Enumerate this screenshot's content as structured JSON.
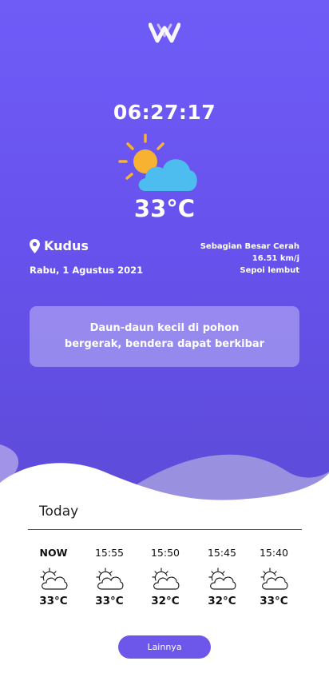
{
  "app": {
    "accent": "#6c57ea",
    "brand_logo": "w-logo"
  },
  "current": {
    "time": "06:27:17",
    "icon": "sun-cloud-icon",
    "temperature": "33°C",
    "location": "Kudus",
    "date": "Rabu, 1 Agustus 2021",
    "condition": "Sebagian Besar Cerah",
    "wind_speed": "16.51 km/j",
    "wind_name": "Sepoi lembut",
    "description": "Daun-daun kecil di pohon bergerak, bendera dapat berkibar"
  },
  "forecast": {
    "title": "Today",
    "items": [
      {
        "time": "NOW",
        "icon": "cloud-sun-outline-icon",
        "temp": "33°C"
      },
      {
        "time": "15:55",
        "icon": "cloud-sun-outline-icon",
        "temp": "33°C"
      },
      {
        "time": "15:50",
        "icon": "cloud-sun-outline-icon",
        "temp": "32°C"
      },
      {
        "time": "15:45",
        "icon": "cloud-sun-outline-icon",
        "temp": "32°C"
      },
      {
        "time": "15:40",
        "icon": "cloud-sun-outline-icon",
        "temp": "33°C"
      }
    ],
    "more_label": "Lainnya"
  }
}
